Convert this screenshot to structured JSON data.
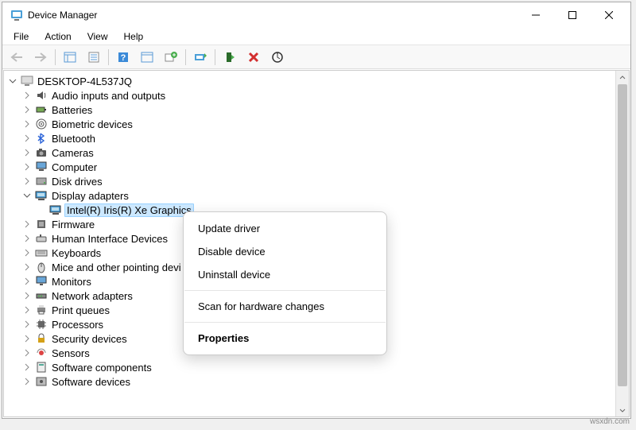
{
  "window": {
    "title": "Device Manager"
  },
  "menu": {
    "file": "File",
    "action": "Action",
    "view": "View",
    "help": "Help"
  },
  "tree": {
    "root": "DESKTOP-4L537JQ",
    "items": [
      "Audio inputs and outputs",
      "Batteries",
      "Biometric devices",
      "Bluetooth",
      "Cameras",
      "Computer",
      "Disk drives",
      "Display adapters",
      "Firmware",
      "Human Interface Devices",
      "Keyboards",
      "Mice and other pointing devi",
      "Monitors",
      "Network adapters",
      "Print queues",
      "Processors",
      "Security devices",
      "Sensors",
      "Software components",
      "Software devices"
    ],
    "selected_child": "Intel(R) Iris(R) Xe Graphics"
  },
  "context_menu": {
    "update": "Update driver",
    "disable": "Disable device",
    "uninstall": "Uninstall device",
    "scan": "Scan for hardware changes",
    "properties": "Properties"
  },
  "watermark": "wsxdn.com"
}
